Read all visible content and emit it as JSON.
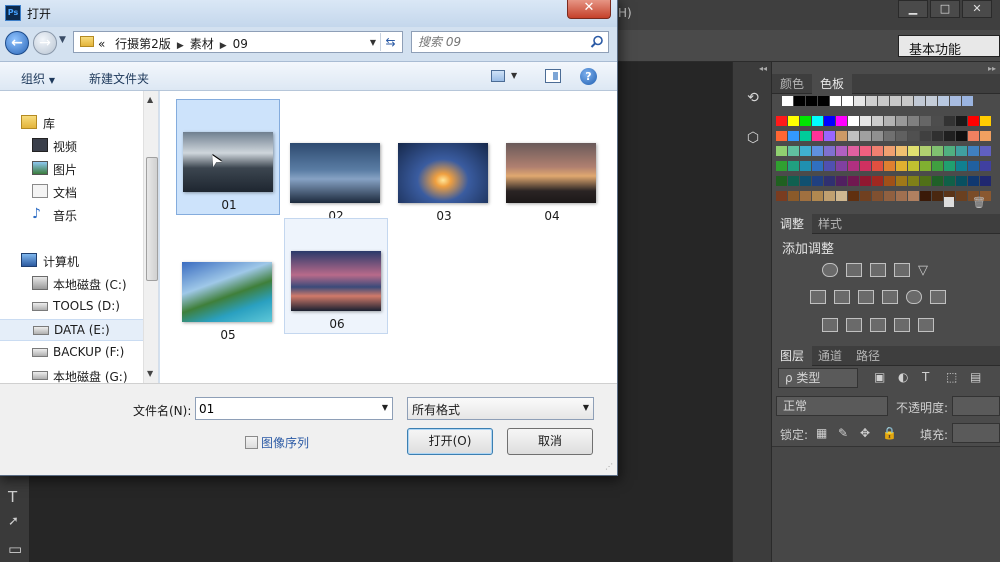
{
  "photoshop": {
    "menu_tail": "H)",
    "workspace": "基本功能",
    "panels": {
      "color_tab": "颜色",
      "swatches_tab": "色板",
      "adjustments_tab": "调整",
      "styles_tab": "样式",
      "adjustments_title": "添加调整",
      "layers_tab": "图层",
      "channels_tab": "通道",
      "paths_tab": "路径",
      "layer_filter": "ρ 类型",
      "blend_mode": "正常",
      "opacity_label": "不透明度:",
      "lock_label": "锁定:",
      "fill_label": "填充:"
    },
    "swatch_colors": {
      "row0": [
        "#ffffff",
        "#000000",
        "#000000",
        "#000000",
        "#ffffff",
        "#ffffff",
        "#e6e6e6",
        "#cfcfcf",
        "#c8c8c8",
        "#c8c8c8",
        "#c8c8c8",
        "#c0c8d4",
        "#c4ccd8",
        "#b8c8e0",
        "#a8bce0",
        "#9ab4e0"
      ],
      "row1": [
        "#ff1a1a",
        "#ffff00",
        "#00e600",
        "#00ffff",
        "#0000ff",
        "#ff00ff",
        "#ffffff",
        "#e6e6e6",
        "#cccccc",
        "#b3b3b3",
        "#999999",
        "#808080",
        "#666666",
        "#4d4d4d",
        "#333333",
        "#1a1a1a",
        "#ff0000",
        "#ffcc00"
      ],
      "row2": [
        "#ff6633",
        "#3399ff",
        "#00cc99",
        "#ff3399",
        "#9966ff",
        "#cc9966",
        "#c0c0c0",
        "#a0a0a0",
        "#909090",
        "#707070",
        "#606060",
        "#505050",
        "#404040",
        "#303030",
        "#202020",
        "#101010",
        "#f08060",
        "#f0a060"
      ],
      "row3": [
        "#90d070",
        "#60c0a0",
        "#40b0d0",
        "#6090e0",
        "#8070d0",
        "#b060c0",
        "#e060a0",
        "#f06080",
        "#f08070",
        "#f0a070",
        "#f0c070",
        "#e0e070",
        "#b0d070",
        "#80c070",
        "#50b080",
        "#40a0a0",
        "#4080c0",
        "#6060c0"
      ],
      "row4": [
        "#30a030",
        "#20a080",
        "#2090b0",
        "#3070c0",
        "#5050b0",
        "#8040a0",
        "#b03080",
        "#d03060",
        "#e05040",
        "#e08030",
        "#e0b030",
        "#c0c030",
        "#80b030",
        "#40a040",
        "#20a070",
        "#108090",
        "#2060a0",
        "#4040a0"
      ],
      "row5": [
        "#206020",
        "#106050",
        "#105070",
        "#204080",
        "#303070",
        "#502060",
        "#701850",
        "#901830",
        "#a02820",
        "#a05018",
        "#a07818",
        "#808018",
        "#507018",
        "#206028",
        "#106048",
        "#085060",
        "#103870",
        "#202870"
      ],
      "row6": [
        "#7a3c20",
        "#8a5a2a",
        "#a07040",
        "#b08850",
        "#c0a070",
        "#d0b890",
        "#603010",
        "#704020",
        "#805030",
        "#906040",
        "#a07050",
        "#b08060",
        "#3a1a08",
        "#4a2810",
        "#5a3418",
        "#6a4020",
        "#7a4c28",
        "#8a5830"
      ]
    }
  },
  "dialog": {
    "title": "打开",
    "close_symbol": "✕",
    "address": {
      "prefix": "«",
      "crumbs": [
        "行摄第2版",
        "素材",
        "09"
      ]
    },
    "search_placeholder": "搜索 09",
    "toolbar": {
      "organize": "组织",
      "new_folder": "新建文件夹"
    },
    "nav": [
      {
        "label": "库",
        "icon": "library-icon",
        "indent": 0
      },
      {
        "label": "视频",
        "icon": "video-icon",
        "indent": 1
      },
      {
        "label": "图片",
        "icon": "pictures-icon",
        "indent": 1
      },
      {
        "label": "文档",
        "icon": "documents-icon",
        "indent": 1
      },
      {
        "label": "音乐",
        "icon": "music-icon",
        "indent": 1
      },
      {
        "label": "计算机",
        "icon": "computer-icon",
        "indent": 0
      },
      {
        "label": "本地磁盘 (C:)",
        "icon": "system-drive-icon",
        "indent": 1
      },
      {
        "label": "TOOLS (D:)",
        "icon": "drive-icon",
        "indent": 1
      },
      {
        "label": "DATA (E:)",
        "icon": "drive-icon",
        "indent": 1
      },
      {
        "label": "BACKUP (F:)",
        "icon": "drive-icon",
        "indent": 1
      },
      {
        "label": "本地磁盘 (G:)",
        "icon": "drive-icon",
        "indent": 1
      }
    ],
    "files": [
      {
        "name": "01",
        "state": "selected"
      },
      {
        "name": "02",
        "state": "normal"
      },
      {
        "name": "03",
        "state": "normal"
      },
      {
        "name": "04",
        "state": "normal"
      },
      {
        "name": "05",
        "state": "normal"
      },
      {
        "name": "06",
        "state": "hover"
      }
    ],
    "filename_label": "文件名(N):",
    "filename_value": "01",
    "filetype_value": "所有格式",
    "image_sequence_label": "图像序列",
    "open_button": "打开(O)",
    "cancel_button": "取消"
  }
}
